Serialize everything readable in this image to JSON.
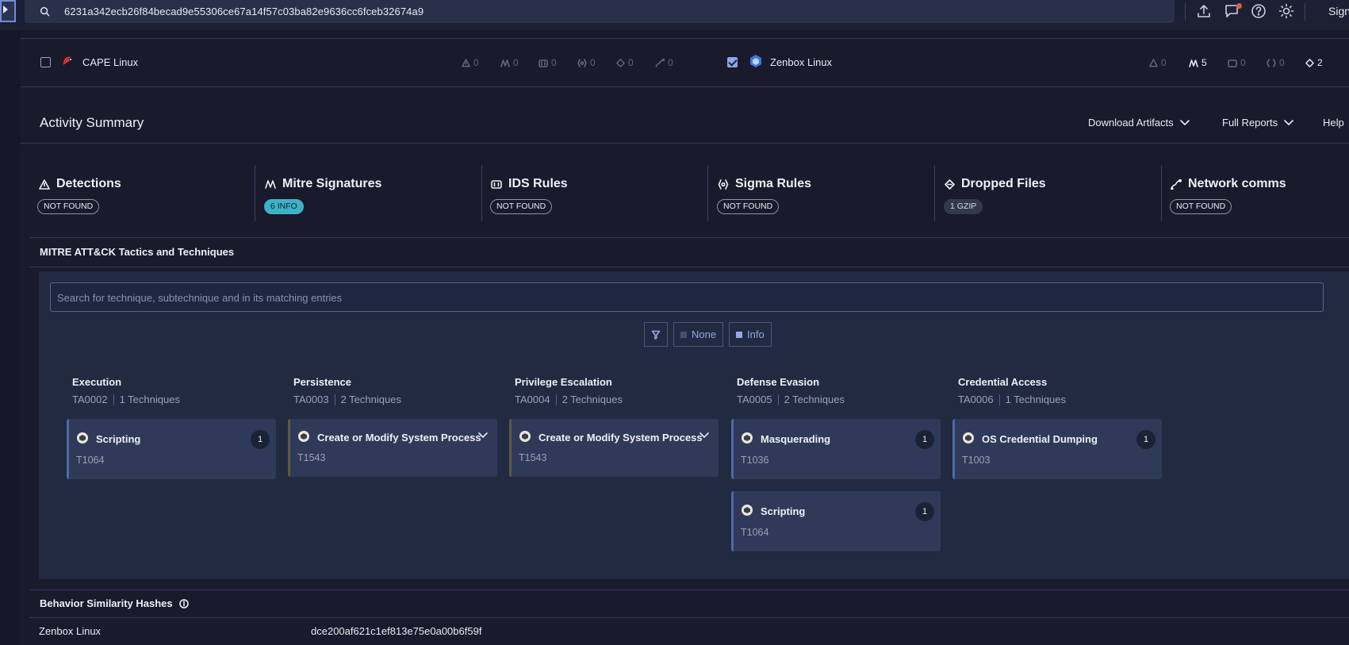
{
  "search": {
    "value": "6231a342ecb26f84becad9e55306ce67a14f57c03ba82e9636cc6fceb32674a9"
  },
  "header": {
    "signin_label": "Sign"
  },
  "sandboxes": [
    {
      "name": "CAPE Linux",
      "checked": false,
      "stats": [
        "0",
        "0",
        "0",
        "0",
        "0",
        "0"
      ]
    },
    {
      "name": "Zenbox Linux",
      "checked": true,
      "stats": [
        "0",
        "5",
        "0",
        "0",
        "2"
      ]
    }
  ],
  "activity": {
    "title": "Activity Summary",
    "menu": {
      "download": "Download Artifacts",
      "full_reports": "Full Reports",
      "help": "Help"
    },
    "cards": [
      {
        "title": "Detections",
        "badge": "NOT FOUND",
        "icon": "warning-icon"
      },
      {
        "title": "Mitre Signatures",
        "badge": "6 INFO",
        "icon": "mitre-icon"
      },
      {
        "title": "IDS Rules",
        "badge": "NOT FOUND",
        "icon": "ids-icon"
      },
      {
        "title": "Sigma Rules",
        "badge": "NOT FOUND",
        "icon": "sigma-icon"
      },
      {
        "title": "Dropped Files",
        "badge": "1 GZIP",
        "icon": "dropped-files-icon"
      },
      {
        "title": "Network comms",
        "badge": "NOT FOUND",
        "icon": "network-icon"
      }
    ]
  },
  "mitre": {
    "title": "MITRE ATT&CK Tactics and Techniques",
    "search_placeholder": "Search for technique, subtechnique and in its matching entries",
    "filters": {
      "none": "None",
      "info": "Info"
    },
    "tactics": [
      {
        "name": "Execution",
        "id": "TA0002",
        "count": "1 Techniques",
        "techniques": [
          {
            "name": "Scripting",
            "id": "T1064",
            "count": "1"
          }
        ]
      },
      {
        "name": "Persistence",
        "id": "TA0003",
        "count": "2 Techniques",
        "techniques": [
          {
            "name": "Create or Modify System Process",
            "id": "T1543"
          }
        ]
      },
      {
        "name": "Privilege Escalation",
        "id": "TA0004",
        "count": "2 Techniques",
        "techniques": [
          {
            "name": "Create or Modify System Process",
            "id": "T1543"
          }
        ]
      },
      {
        "name": "Defense Evasion",
        "id": "TA0005",
        "count": "2 Techniques",
        "techniques": [
          {
            "name": "Masquerading",
            "id": "T1036",
            "count": "1"
          },
          {
            "name": "Scripting",
            "id": "T1064",
            "count": "1"
          }
        ]
      },
      {
        "name": "Credential Access",
        "id": "TA0006",
        "count": "1 Techniques",
        "techniques": [
          {
            "name": "OS Credential Dumping",
            "id": "T1003",
            "count": "1"
          }
        ]
      }
    ]
  },
  "bsh": {
    "title": "Behavior Similarity Hashes",
    "rows": [
      {
        "label": "Zenbox Linux",
        "hash": "dce200af621c1ef813e75e0a00b6f59f"
      }
    ]
  }
}
